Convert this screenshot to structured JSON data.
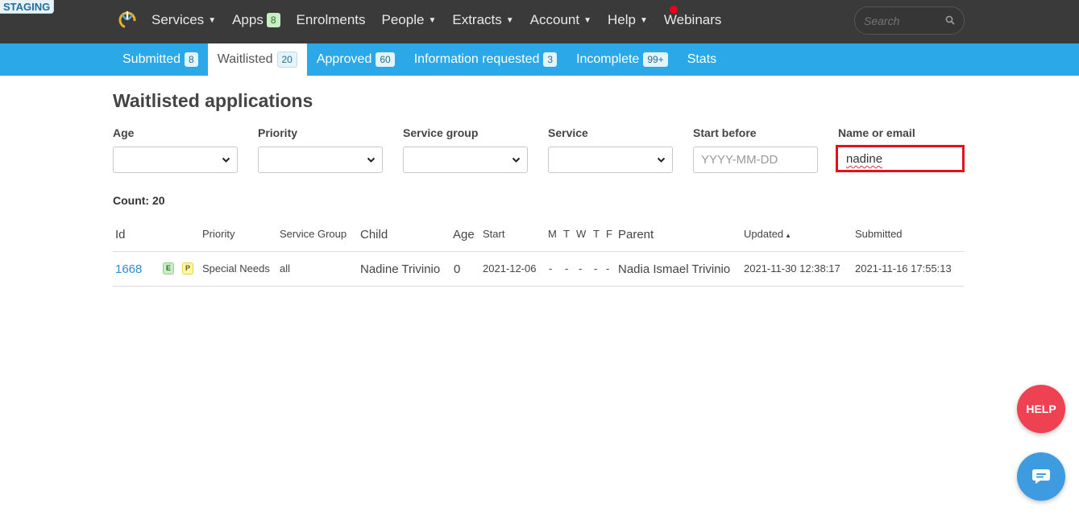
{
  "env_badge": "STAGING",
  "nav": {
    "items": [
      {
        "label": "Services",
        "dropdown": true
      },
      {
        "label": "Apps",
        "badge": "8"
      },
      {
        "label": "Enrolments"
      },
      {
        "label": "People",
        "dropdown": true
      },
      {
        "label": "Extracts",
        "dropdown": true
      },
      {
        "label": "Account",
        "dropdown": true
      },
      {
        "label": "Help",
        "dropdown": true
      },
      {
        "label": "Webinars"
      }
    ],
    "search_placeholder": "Search"
  },
  "tabs": [
    {
      "label": "Submitted",
      "count": "8",
      "active": false
    },
    {
      "label": "Waitlisted",
      "count": "20",
      "active": true
    },
    {
      "label": "Approved",
      "count": "60",
      "active": false
    },
    {
      "label": "Information requested",
      "count": "3",
      "active": false
    },
    {
      "label": "Incomplete",
      "count": "99+",
      "active": false
    },
    {
      "label": "Stats",
      "count": null,
      "active": false
    }
  ],
  "page_title": "Waitlisted applications",
  "filters": {
    "age_label": "Age",
    "priority_label": "Priority",
    "service_group_label": "Service group",
    "service_label": "Service",
    "start_before_label": "Start before",
    "start_before_placeholder": "YYYY-MM-DD",
    "name_email_label": "Name or email",
    "name_email_value": "nadine"
  },
  "count_text": "Count: 20",
  "table": {
    "headers": {
      "id": "Id",
      "priority": "Priority",
      "service_group": "Service Group",
      "child": "Child",
      "age": "Age",
      "start": "Start",
      "m": "M",
      "t1": "T",
      "w": "W",
      "t2": "T",
      "f": "F",
      "parent": "Parent",
      "updated": "Updated",
      "updated_sort": "▲",
      "submitted": "Submitted"
    },
    "rows": [
      {
        "id": "1668",
        "tags": [
          "E",
          "P"
        ],
        "priority": "Special Needs",
        "service_group": "all",
        "child": "Nadine Trivinio",
        "age": "0",
        "start": "2021-12-06",
        "days": [
          "-",
          "-",
          "-",
          "-",
          "-"
        ],
        "parent": "Nadia Ismael Trivinio",
        "updated": "2021-11-30 12:38:17",
        "submitted": "2021-11-16 17:55:13"
      }
    ]
  },
  "help_button": "HELP",
  "colors": {
    "topbar": "#3a3a3a",
    "tabbar": "#2aa8e8",
    "highlight": "#e0121e",
    "help": "#ee4152",
    "chat": "#3e9be0"
  }
}
